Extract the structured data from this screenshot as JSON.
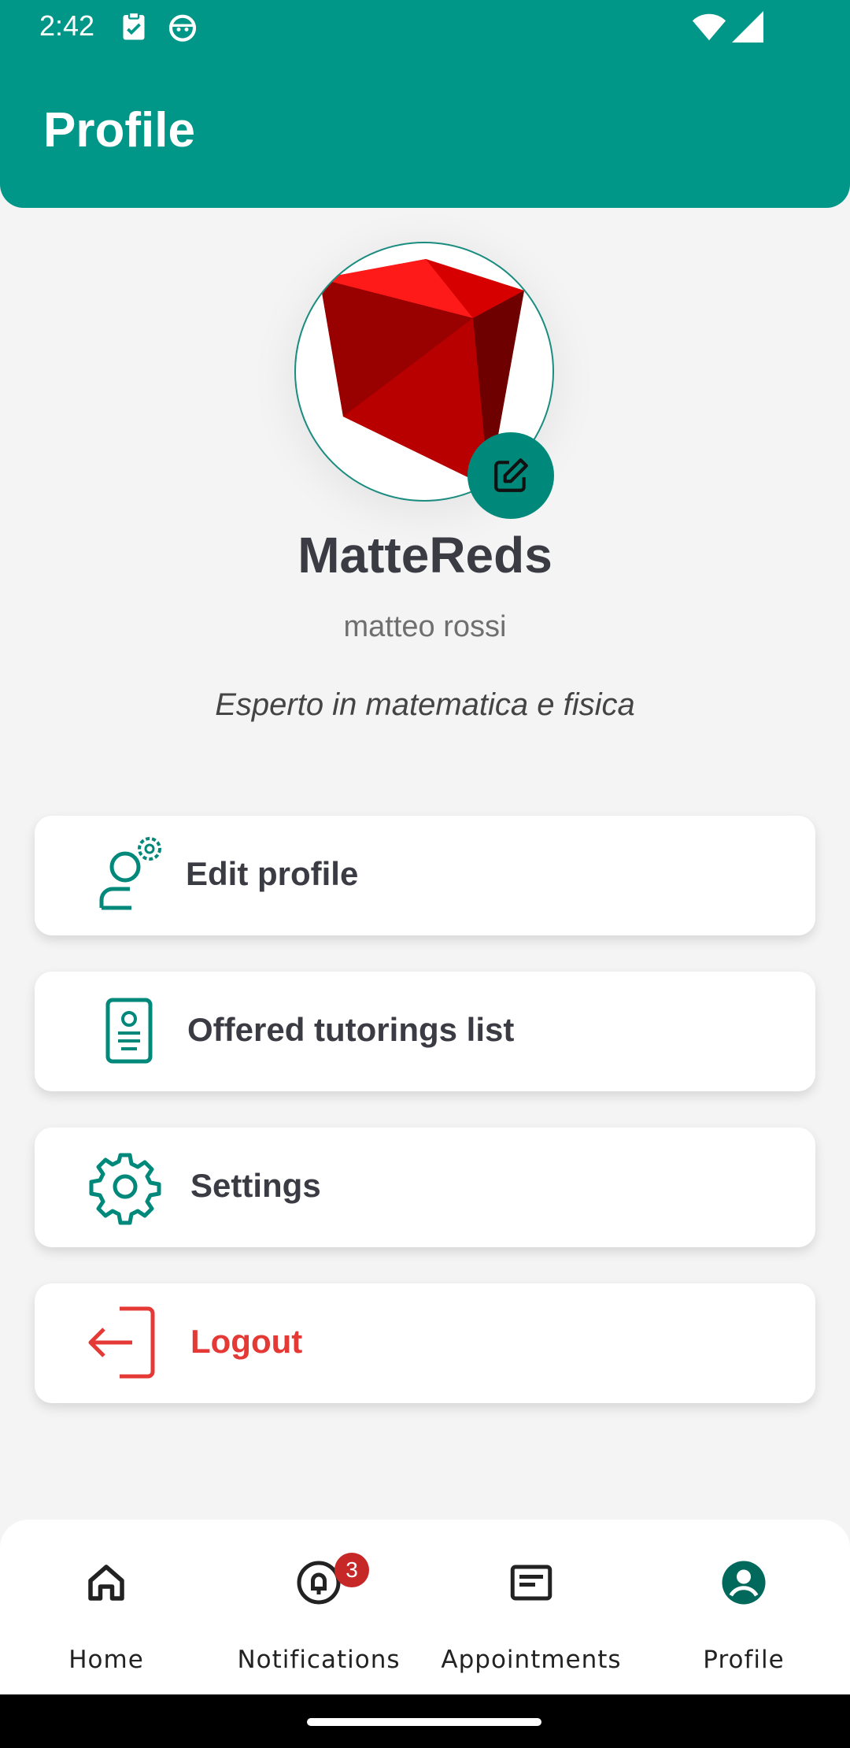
{
  "status": {
    "time": "2:42"
  },
  "header": {
    "title": "Profile"
  },
  "profile": {
    "username": "MatteReds",
    "full_name": "matteo rossi",
    "bio": "Esperto in matematica e fisica"
  },
  "menu": [
    {
      "label": "Edit profile",
      "icon": "user-settings-icon"
    },
    {
      "label": "Offered tutorings list",
      "icon": "document-icon"
    },
    {
      "label": "Settings",
      "icon": "gear-icon"
    },
    {
      "label": "Logout",
      "icon": "logout-icon"
    }
  ],
  "nav": {
    "items": [
      {
        "label": "Home",
        "icon": "home-icon"
      },
      {
        "label": "Notifications",
        "icon": "bell-icon",
        "badge": "3"
      },
      {
        "label": "Appointments",
        "icon": "calendar-card-icon"
      },
      {
        "label": "Profile",
        "icon": "account-circle-icon"
      }
    ]
  },
  "colors": {
    "primary": "#009688",
    "danger": "#e53935",
    "badge": "#c62828"
  }
}
